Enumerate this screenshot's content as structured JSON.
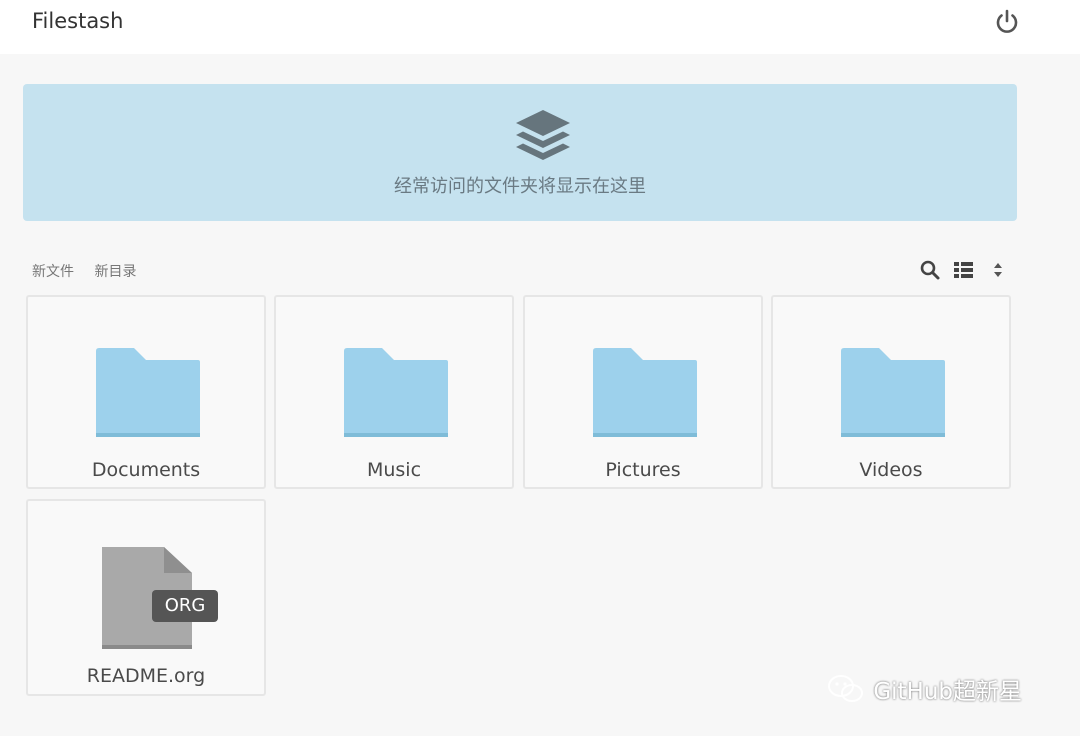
{
  "header": {
    "title": "Filestash",
    "power_icon": "power-icon"
  },
  "banner": {
    "text": "经常访问的文件夹将显示在这里",
    "icon": "layers-icon"
  },
  "actions": {
    "new_file": "新文件",
    "new_dir": "新目录"
  },
  "toolbar": {
    "search_icon": "search-icon",
    "list_icon": "list-view-icon",
    "sort_icon": "sort-icon"
  },
  "items": [
    {
      "name": "Documents",
      "kind": "folder"
    },
    {
      "name": "Music",
      "kind": "folder"
    },
    {
      "name": "Pictures",
      "kind": "folder"
    },
    {
      "name": "Videos",
      "kind": "folder"
    },
    {
      "name": "README.org",
      "kind": "file",
      "badge": "ORG"
    }
  ],
  "watermark": {
    "text": "GitHub超新星"
  },
  "colors": {
    "folder": "#9dd1ec",
    "folder_edge": "#7fbcd8",
    "banner": "#c5e2ef",
    "file": "#a9a9a9"
  }
}
